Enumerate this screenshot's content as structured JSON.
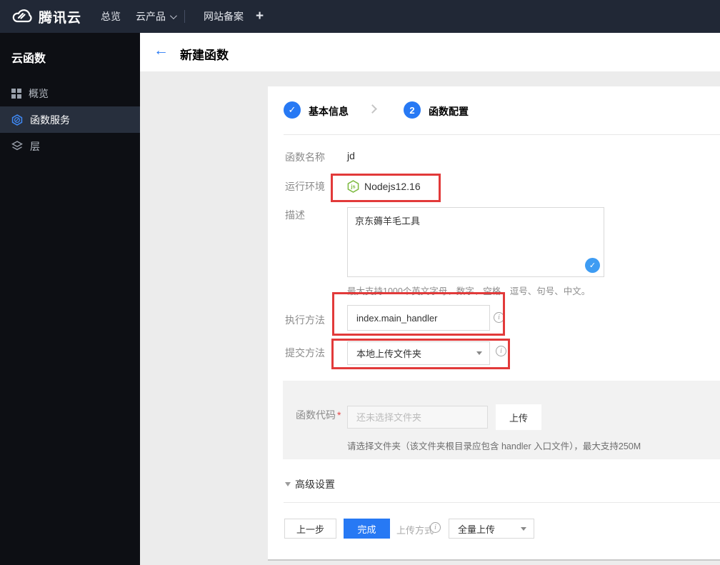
{
  "topbar": {
    "brand": "腾讯云",
    "overview": "总览",
    "products": "云产品",
    "beian": "网站备案",
    "plus": "+"
  },
  "sidebar": {
    "title": "云函数",
    "items": [
      {
        "label": "概览",
        "icon": "grid-icon",
        "selected": false
      },
      {
        "label": "函数服务",
        "icon": "function-icon",
        "selected": true
      },
      {
        "label": "层",
        "icon": "layers-icon",
        "selected": false
      }
    ]
  },
  "header": {
    "back": "←",
    "title": "新建函数"
  },
  "steps": {
    "step1": {
      "glyph": "✓",
      "label": "基本信息"
    },
    "step2": {
      "num": "2",
      "label": "函数配置"
    }
  },
  "form": {
    "name_label": "函数名称",
    "name_value": "jd",
    "runtime_label": "运行环境",
    "runtime_icon": "nodejs-icon",
    "runtime_value": "Nodejs12.16",
    "desc_label": "描述",
    "desc_value": "京东薅羊毛工具",
    "desc_badge": "✓",
    "desc_hint": "最大支持1000个英文字母、数字、空格、逗号、句号、中文。",
    "handler_label": "执行方法",
    "handler_value": "index.main_handler",
    "submit_label": "提交方法",
    "submit_value": "本地上传文件夹",
    "info_glyph": "i",
    "code_label": "函数代码",
    "code_required": "*",
    "code_placeholder": "还未选择文件夹",
    "upload_button": "上传",
    "code_hint": "请选择文件夹（该文件夹根目录应包含 handler 入口文件），最大支持250M",
    "advanced_label": "高级设置"
  },
  "footer": {
    "prev": "上一步",
    "finish": "完成",
    "upload_mode_label": "上传方式",
    "upload_mode_value": "全量上传"
  },
  "colors": {
    "accent_blue": "#2779f4",
    "badge_blue": "#3e9cf3",
    "annotation_red": "#e23a3a",
    "node_green": "#7cb93e",
    "topbar_bg": "#212836",
    "sidebar_bg": "#0d0f14"
  }
}
